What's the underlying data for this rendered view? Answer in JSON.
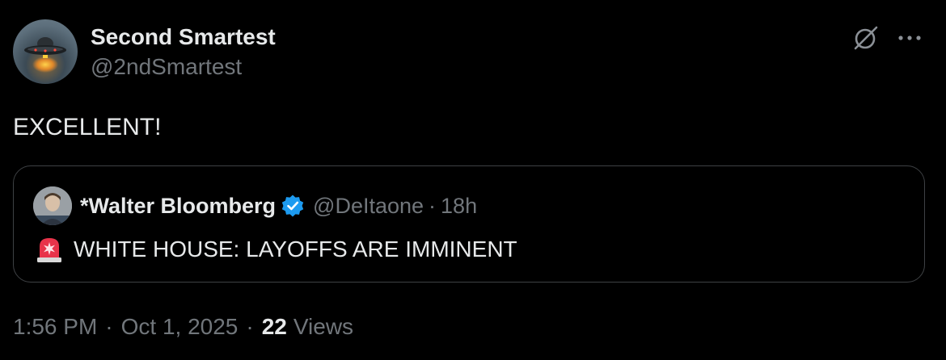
{
  "author": {
    "display_name": "Second Smartest",
    "handle": "@2ndSmartest",
    "avatar_icon": "ufo-avatar"
  },
  "header_icons": [
    "grok-icon",
    "more-icon"
  ],
  "tweet": {
    "text": "EXCELLENT!"
  },
  "quote": {
    "display_name": "*Walter Bloomberg",
    "handle": "@DeItaone",
    "separator": "·",
    "time": "18h",
    "verified_icon": "verified-badge-icon",
    "emoji_icon": "rotating-light-icon",
    "text": "WHITE HOUSE: LAYOFFS ARE IMMINENT"
  },
  "meta": {
    "time": "1:56 PM",
    "separator": "·",
    "date": "Oct 1, 2025",
    "views_count": "22",
    "views_label": "Views"
  },
  "colors": {
    "background": "#000000",
    "primary_text": "#e7e9ea",
    "secondary_text": "#71767b",
    "border": "#3e4144",
    "verified": "#1d9bf0"
  }
}
